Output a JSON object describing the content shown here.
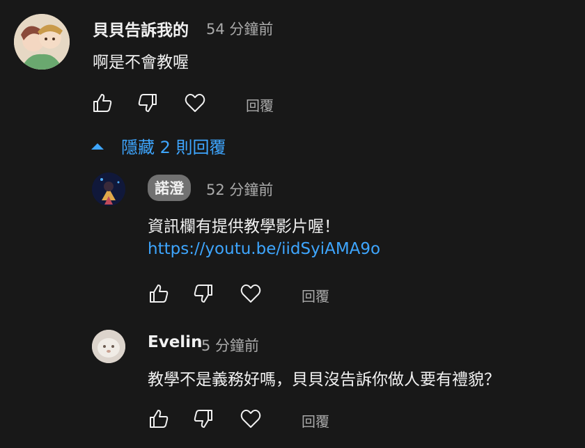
{
  "comment": {
    "author": "貝貝告訴我的",
    "time": "54 分鐘前",
    "text": "啊是不會教喔",
    "reply_label": "回覆"
  },
  "toggle": {
    "label": "隱藏 2 則回覆",
    "icon": "caret-up-icon"
  },
  "replies": [
    {
      "author": "諾澄",
      "time": "52 分鐘前",
      "text": "資訊欄有提供教學影片喔！",
      "link": "https://youtu.be/iidSyiAMA9o",
      "reply_label": "回覆"
    },
    {
      "author": "Evelin",
      "time": "5 分鐘前",
      "text": "教學不是義務好嗎，貝貝沒告訴你做人要有禮貌？",
      "reply_label": "回覆"
    }
  ],
  "colors": {
    "background": "#181818",
    "text": "#f1f1f1",
    "secondary": "#aaaaaa",
    "link": "#3ea6ff",
    "chip": "#717171"
  }
}
